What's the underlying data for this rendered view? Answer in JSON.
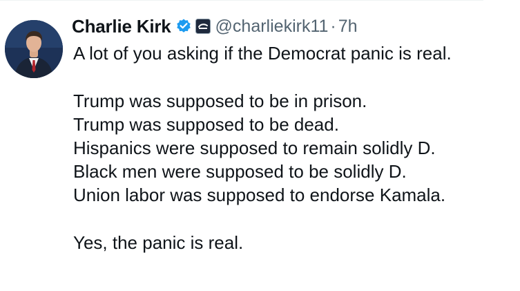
{
  "tweet": {
    "author": {
      "display_name": "Charlie Kirk",
      "handle": "@charliekirk11",
      "verified_icon": "verified-badge-icon",
      "affiliate_icon": "affiliate-badge-icon",
      "avatar": "avatar"
    },
    "separator": "·",
    "timestamp": "7h",
    "body": {
      "line1": "A lot of you asking if the Democrat panic is real.",
      "line2": "Trump was supposed to be in prison.",
      "line3": "Trump was supposed to be dead.",
      "line4": "Hispanics were supposed to remain solidly D.",
      "line5": "Black men were supposed to be solidly D.",
      "line6": "Union labor was supposed to endorse Kamala.",
      "line7": "Yes, the panic is real."
    },
    "colors": {
      "text": "#0f1419",
      "secondary": "#536471",
      "verified_blue": "#1d9bf0"
    }
  }
}
